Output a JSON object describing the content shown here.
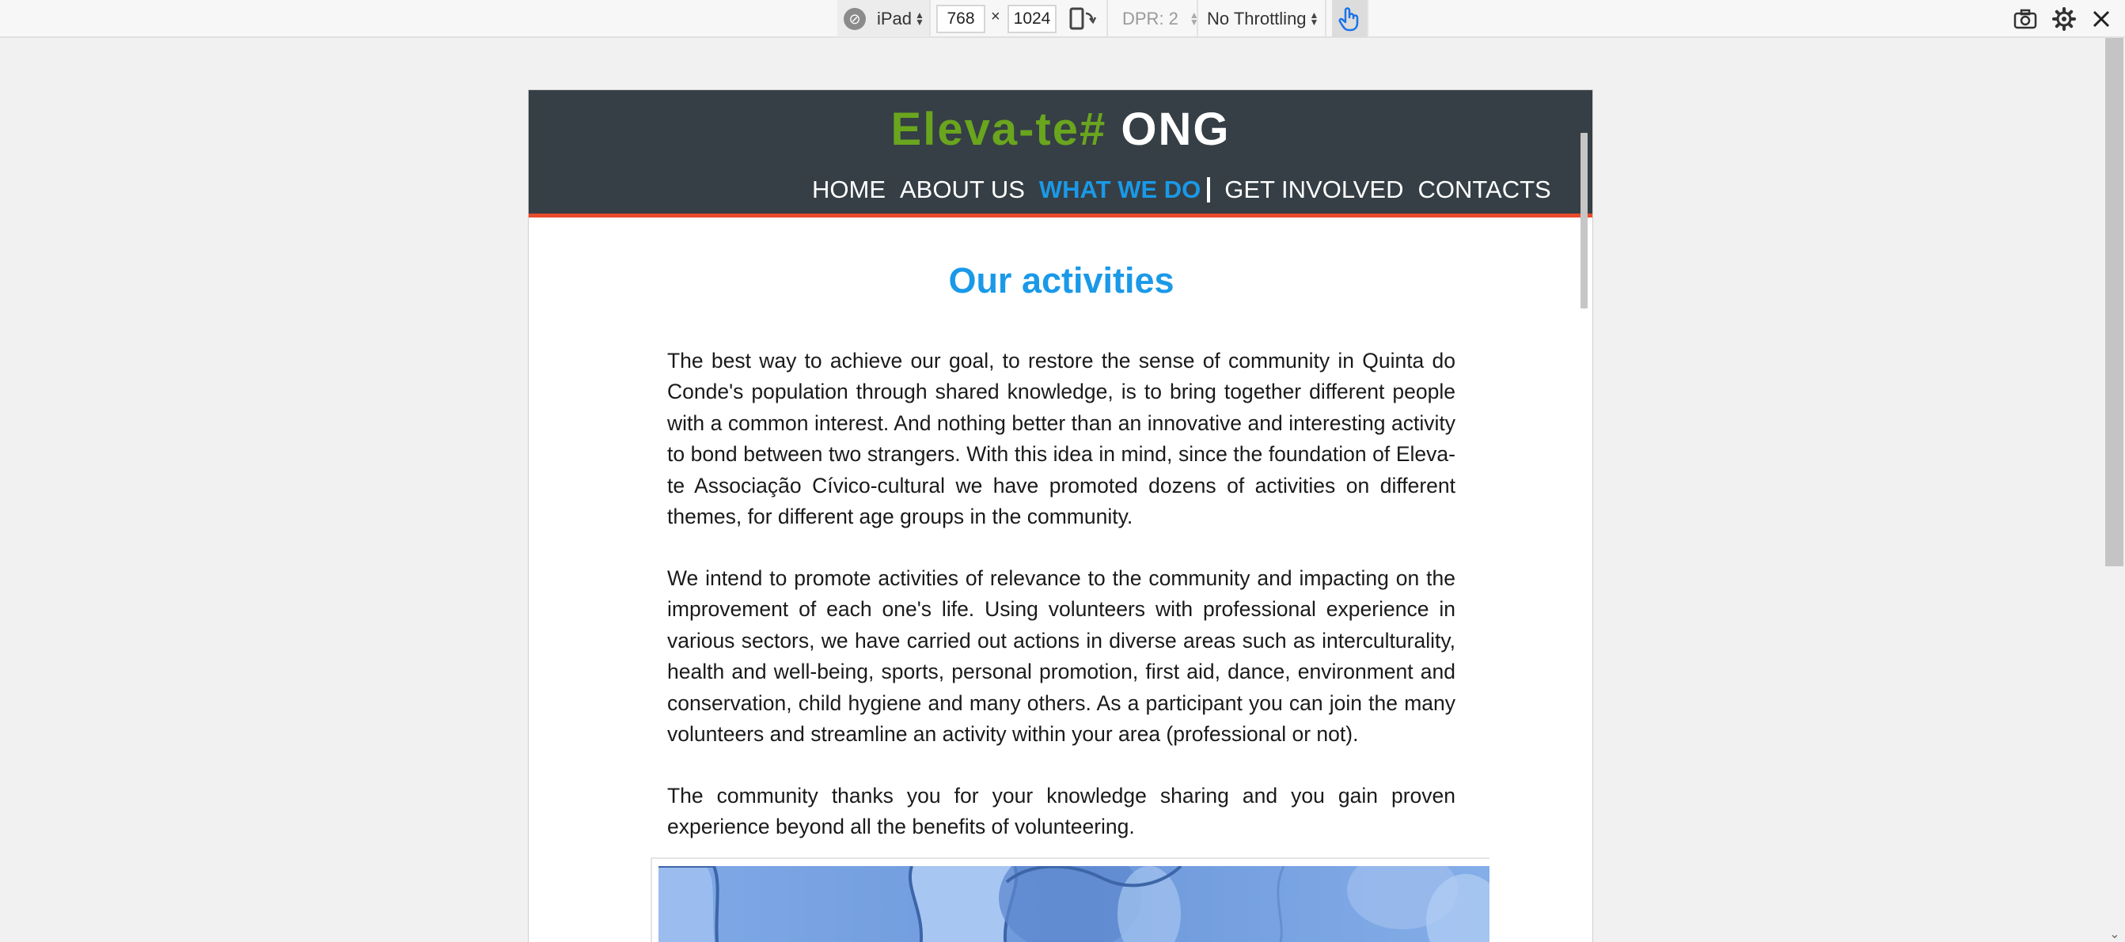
{
  "devtools": {
    "device_name": "iPad",
    "width": "768",
    "times": "×",
    "height": "1024",
    "dpr_label": "DPR: 2",
    "throttling": "No Throttling"
  },
  "site": {
    "logo_green": "Eleva-te#",
    "logo_white": "ONG",
    "nav": [
      "HOME",
      "ABOUT US",
      "WHAT WE DO",
      "GET INVOLVED",
      "CONTACTS"
    ],
    "active_nav": "WHAT WE DO"
  },
  "page": {
    "title": "Our activities",
    "paragraphs": [
      "The best way to achieve our goal, to restore the sense of community in Quinta do Conde's population through shared knowledge, is to bring together different people with a common interest. And nothing better than an innovative and interesting activity to bond between two strangers. With this idea in mind, since the foundation of Eleva-te Associação Cívico-cultural we have promoted dozens of activities on different themes, for different age groups in the community.",
      "We intend to promote activities of relevance to the community and impacting on the improvement of each one's life. Using volunteers with professional experience in various sectors, we have carried out actions in diverse areas such as interculturality, health and well-being, sports, personal promotion, first aid, dance, environment and conservation, child hygiene and many others. As a participant you can join the many volunteers and streamline an activity within your area (professional or not).",
      "The community thanks you for your knowledge sharing and you gain proven experience beyond all the benefits of volunteering."
    ]
  },
  "colors": {
    "header_bg": "#353f45",
    "header_border": "#e94b2c",
    "logo_green": "#6aa51e",
    "accent_blue": "#1a99e8"
  },
  "icons": {
    "device_icon": "compass-disabled-icon",
    "rotate": "rotate-device-icon",
    "touch": "touch-hand-icon",
    "screenshot": "camera-icon",
    "settings": "gear-icon",
    "close": "close-icon"
  }
}
